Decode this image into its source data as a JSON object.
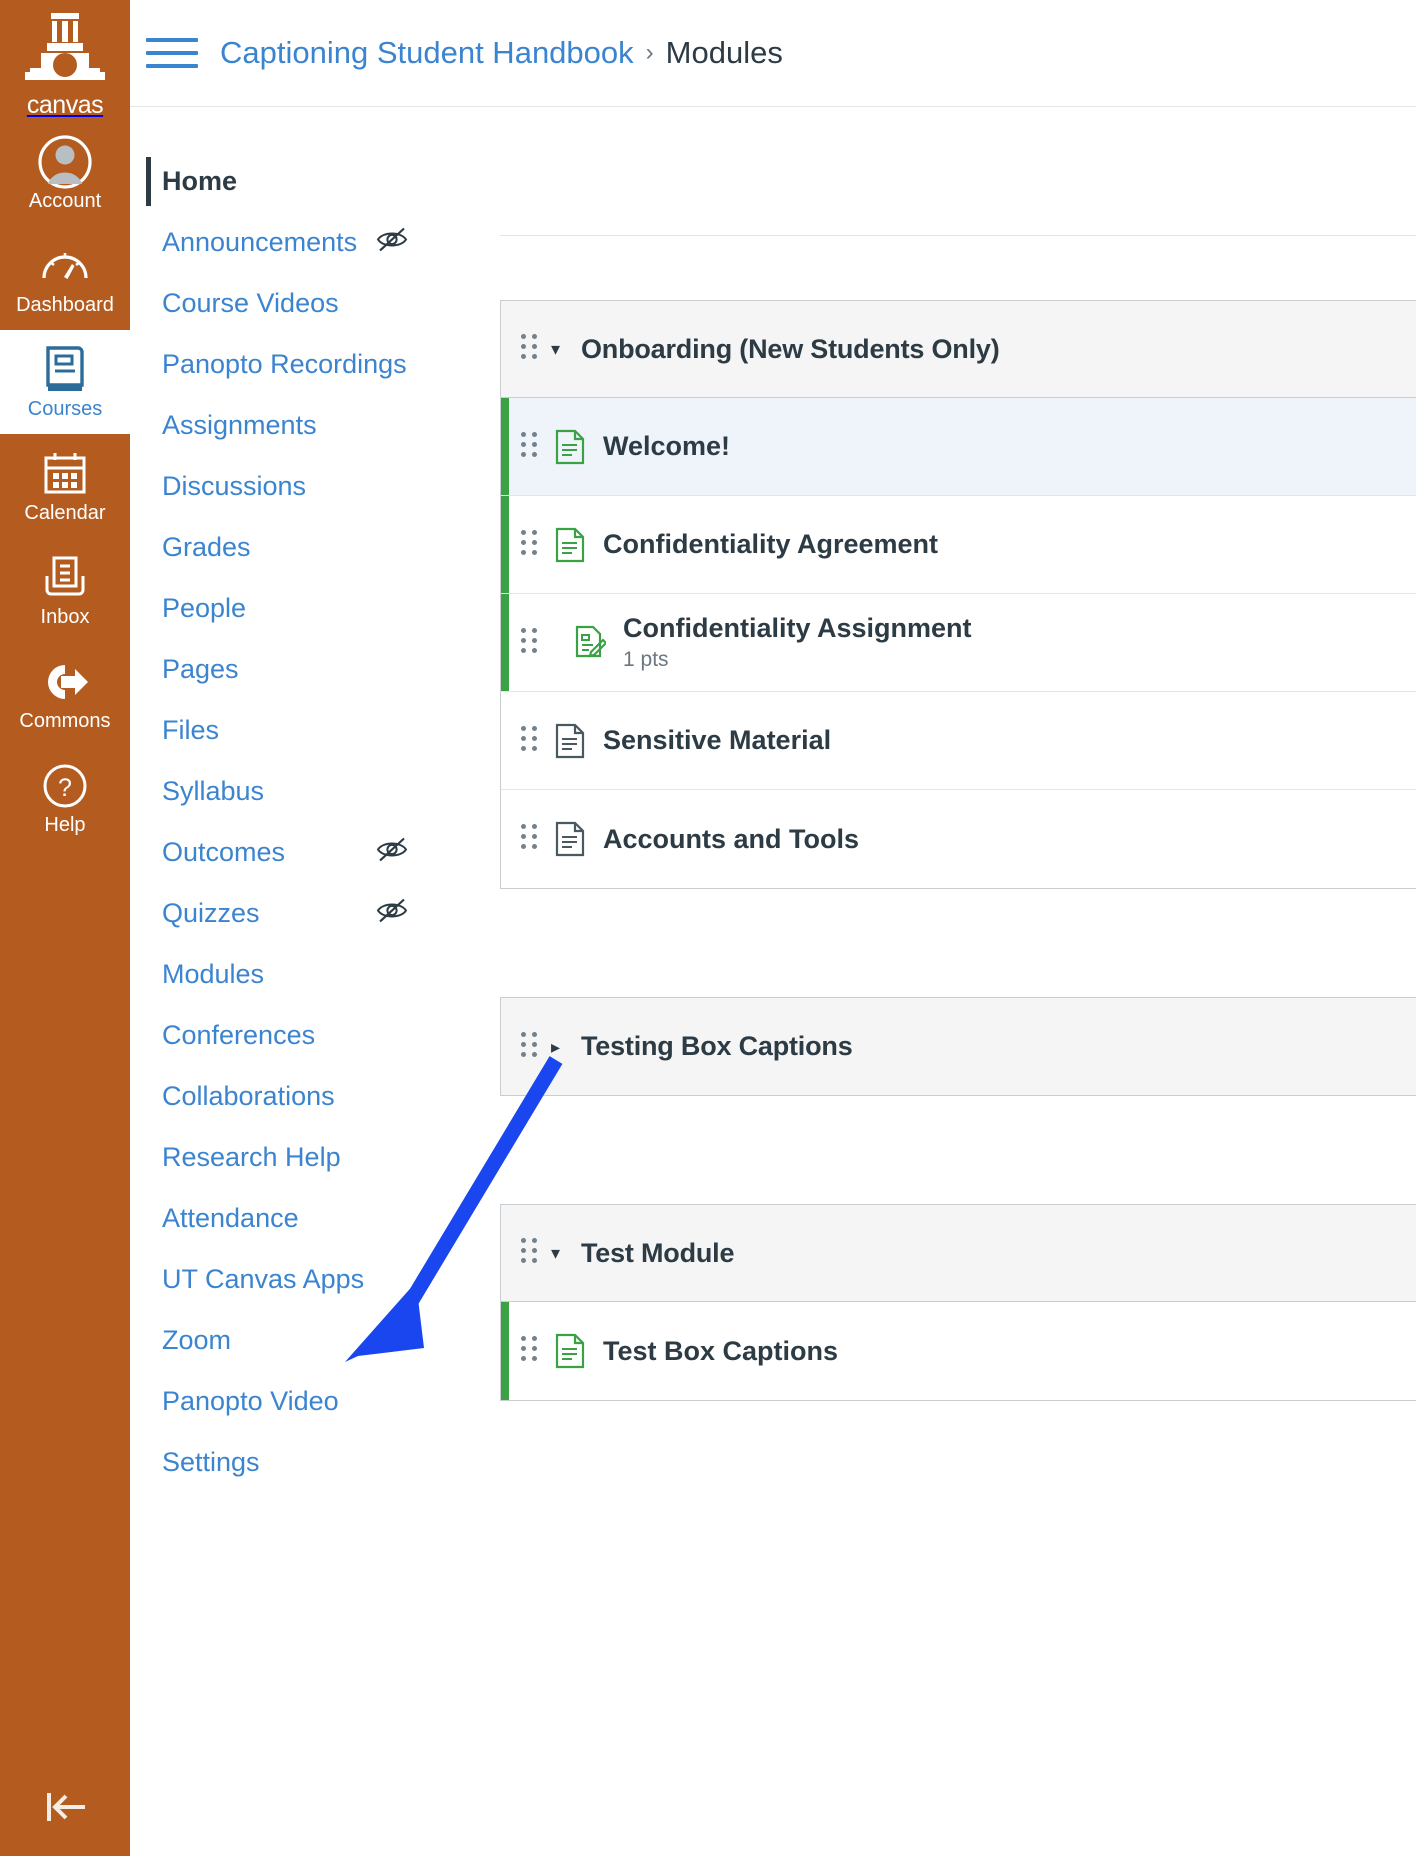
{
  "global_nav": {
    "logo_word": "canvas",
    "logo_icon": "ut-tower-icon",
    "items": [
      {
        "label": "Account",
        "icon": "user-avatar-icon",
        "active": false
      },
      {
        "label": "Dashboard",
        "icon": "dashboard-gauge-icon",
        "active": false
      },
      {
        "label": "Courses",
        "icon": "book-icon",
        "active": true
      },
      {
        "label": "Calendar",
        "icon": "calendar-icon",
        "active": false
      },
      {
        "label": "Inbox",
        "icon": "inbox-tray-icon",
        "active": false
      },
      {
        "label": "Commons",
        "icon": "commons-arrow-icon",
        "active": false
      },
      {
        "label": "Help",
        "icon": "question-circle-icon",
        "active": false
      }
    ],
    "collapse_icon": "collapse-left-arrow-icon"
  },
  "header": {
    "menu_icon": "hamburger-menu-icon",
    "breadcrumb": [
      {
        "label": "Captioning Student Handbook",
        "current": false
      },
      {
        "label": "Modules",
        "current": true
      }
    ],
    "breadcrumb_separator": "›"
  },
  "course_nav": {
    "items": [
      {
        "label": "Home",
        "active": true,
        "hidden": false
      },
      {
        "label": "Announcements",
        "active": false,
        "hidden": true
      },
      {
        "label": "Course Videos",
        "active": false,
        "hidden": false
      },
      {
        "label": "Panopto Recordings",
        "active": false,
        "hidden": false
      },
      {
        "label": "Assignments",
        "active": false,
        "hidden": false
      },
      {
        "label": "Discussions",
        "active": false,
        "hidden": false
      },
      {
        "label": "Grades",
        "active": false,
        "hidden": false
      },
      {
        "label": "People",
        "active": false,
        "hidden": false
      },
      {
        "label": "Pages",
        "active": false,
        "hidden": false
      },
      {
        "label": "Files",
        "active": false,
        "hidden": false
      },
      {
        "label": "Syllabus",
        "active": false,
        "hidden": false
      },
      {
        "label": "Outcomes",
        "active": false,
        "hidden": true
      },
      {
        "label": "Quizzes",
        "active": false,
        "hidden": true
      },
      {
        "label": "Modules",
        "active": false,
        "hidden": false
      },
      {
        "label": "Conferences",
        "active": false,
        "hidden": false
      },
      {
        "label": "Collaborations",
        "active": false,
        "hidden": false
      },
      {
        "label": "Research Help",
        "active": false,
        "hidden": false
      },
      {
        "label": "Attendance",
        "active": false,
        "hidden": false
      },
      {
        "label": "UT Canvas Apps",
        "active": false,
        "hidden": false
      },
      {
        "label": "Zoom",
        "active": false,
        "hidden": false
      },
      {
        "label": "Panopto Video",
        "active": false,
        "hidden": false
      },
      {
        "label": "Settings",
        "active": false,
        "hidden": false
      }
    ],
    "hidden_icon": "eye-slash-icon"
  },
  "modules": [
    {
      "title": "Onboarding (New Students Only)",
      "expanded": true,
      "toggle_icon": "triangle-down-icon",
      "drag_icon": "drag-handle-icon",
      "items": [
        {
          "title": "Welcome!",
          "icon": "page-document-icon",
          "published": true,
          "selected": true,
          "indent": false,
          "subtext": ""
        },
        {
          "title": "Confidentiality Agreement",
          "icon": "page-document-icon",
          "published": true,
          "selected": false,
          "indent": false,
          "subtext": ""
        },
        {
          "title": "Confidentiality Assignment",
          "icon": "assignment-pencil-icon",
          "published": true,
          "selected": false,
          "indent": true,
          "subtext": "1 pts"
        },
        {
          "title": "Sensitive Material",
          "icon": "page-document-icon",
          "published": false,
          "selected": false,
          "indent": false,
          "subtext": ""
        },
        {
          "title": "Accounts and Tools",
          "icon": "page-document-icon",
          "published": false,
          "selected": false,
          "indent": false,
          "subtext": ""
        }
      ]
    },
    {
      "title": "Testing Box Captions",
      "expanded": false,
      "toggle_icon": "triangle-right-icon",
      "drag_icon": "drag-handle-icon",
      "items": []
    },
    {
      "title": "Test Module",
      "expanded": true,
      "toggle_icon": "triangle-down-icon",
      "drag_icon": "drag-handle-icon",
      "items": [
        {
          "title": "Test Box Captions",
          "icon": "page-document-icon",
          "published": true,
          "selected": false,
          "indent": false,
          "subtext": ""
        }
      ]
    }
  ],
  "annotation": {
    "arrow_icon": "blue-pointer-arrow",
    "color": "#1a46f0"
  },
  "colors": {
    "brand_nav": "#b45c20",
    "link_blue": "#3b84d0",
    "published_green": "#3aa245",
    "text_dark": "#2d3b45",
    "selected_row": "#eef4fa",
    "annotation_blue": "#1a46f0"
  }
}
